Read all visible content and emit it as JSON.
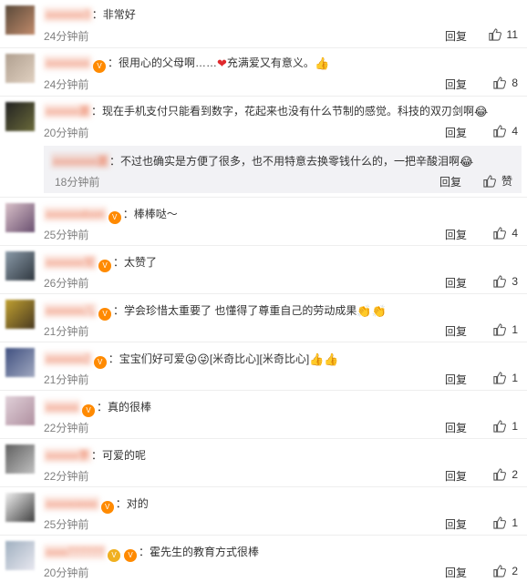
{
  "reply_label": "回复",
  "sub_like_label": "赞",
  "comments": [
    {
      "user": "3",
      "verified": false,
      "text": "：非常好",
      "emoji_after": "",
      "time": "24分钟前",
      "likes": "11"
    },
    {
      "user": "",
      "verified": true,
      "text": "：很用心的父母啊……",
      "heart": "❤",
      "text2": "充满爱又有意义。",
      "emoji_after": "👍",
      "time": "24分钟前",
      "likes": "8"
    },
    {
      "user": "選",
      "verified": false,
      "text": "：现在手机支付只能看到数字，花起来也没有什么节制的感觉。科技的双刃剑啊",
      "emoji_after": "😂",
      "time": "20分钟前",
      "likes": "4"
    },
    {
      "user": "loon",
      "verified": true,
      "text": "：棒棒哒～",
      "emoji_after": "",
      "time": "25分钟前",
      "likes": "4"
    },
    {
      "user": "兒",
      "verified": true,
      "text": "：太赞了",
      "emoji_after": "",
      "time": "26分钟前",
      "likes": "3"
    },
    {
      "user": "儿",
      "verified": true,
      "text": "：学会珍惜太重要了 也懂得了尊重自己的劳动成果",
      "emoji_after": "👏👏",
      "time": "21分钟前",
      "likes": "1"
    },
    {
      "user": "2",
      "verified": true,
      "text": "：宝宝们好可爱",
      "emoji_after": "😜😜",
      "text2": "[米奇比心][米奇比心]",
      "emoji_after2": "👍👍",
      "time": "21分钟前",
      "likes": "1"
    },
    {
      "user": "",
      "verified": true,
      "text": "：真的很棒",
      "emoji_after": "",
      "time": "22分钟前",
      "likes": "1"
    },
    {
      "user": "李",
      "verified": false,
      "text": "：可爱的呢",
      "emoji_after": "",
      "time": "22分钟前",
      "likes": "2"
    },
    {
      "user": "oooo",
      "verified": true,
      "text": "：对的",
      "emoji_after": "",
      "time": "25分钟前",
      "likes": "1"
    },
    {
      "user": "777777",
      "verified": true,
      "text": "：霍先生的教育方式很棒",
      "emoji_after": "",
      "time": "20分钟前",
      "likes": "2"
    }
  ],
  "subreply": {
    "user": "選",
    "text": "：不过也确实是方便了很多，也不用特意去换零钱什么的，一把辛酸泪啊",
    "emoji_after": "😂",
    "time": "18分钟前"
  }
}
